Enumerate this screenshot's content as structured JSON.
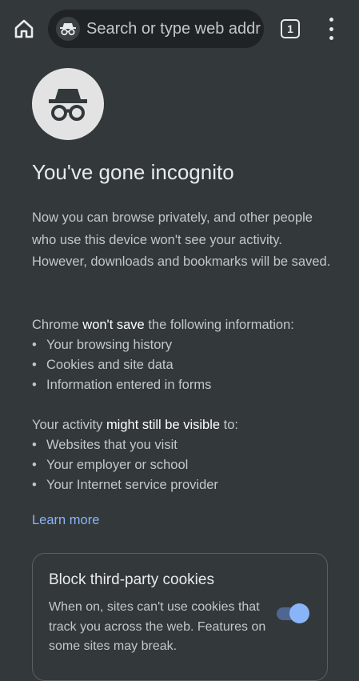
{
  "toolbar": {
    "omnibox_placeholder": "Search or type web addr",
    "tab_count": "1"
  },
  "page": {
    "title": "You've gone incognito",
    "intro": "Now you can browse privately, and other people who use this device won't see your activity. However, downloads and bookmarks will be saved.",
    "wont_save": {
      "prefix": "Chrome ",
      "emphasis": "won't save",
      "suffix": " the following information:",
      "items": [
        "Your browsing history",
        "Cookies and site data",
        "Information entered in forms"
      ]
    },
    "visible": {
      "prefix": "Your activity ",
      "emphasis": "might still be visible",
      "suffix": " to:",
      "items": [
        "Websites that you visit",
        "Your employer or school",
        "Your Internet service provider"
      ]
    },
    "learn_more": "Learn more",
    "bullet": "•"
  },
  "cookies_card": {
    "title": "Block third-party cookies",
    "description": "When on, sites can't use cookies that track you across the web. Features on some sites may break.",
    "toggle_on": true
  },
  "colors": {
    "background": "#33383a",
    "omnibox": "#202325",
    "link": "#8ab4f8",
    "toggle_thumb": "#8ab4f8"
  },
  "icons": {
    "home": "home-icon",
    "incognito": "incognito-icon",
    "tabs": "tab-switcher-icon",
    "menu": "more-vert-icon"
  }
}
